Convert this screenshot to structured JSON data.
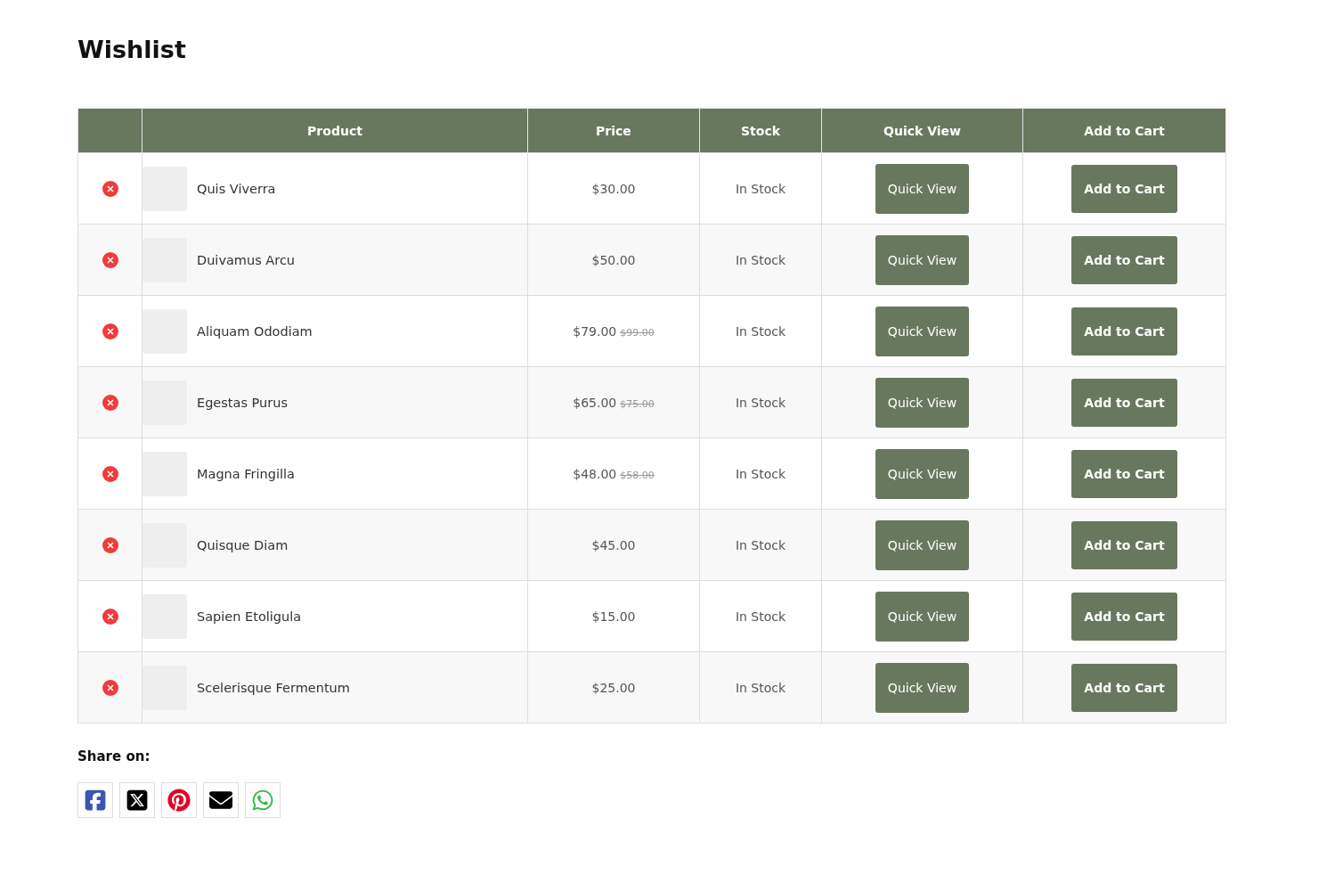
{
  "title": "Wishlist",
  "table": {
    "columns": [
      "Product",
      "Price",
      "Stock",
      "Quick View",
      "Add to Cart"
    ],
    "rows": [
      {
        "name": "Quis Viverra",
        "price": "$30.00",
        "stock": "In Stock",
        "quick_view": "Quick View",
        "add_to_cart": "Add to Cart"
      },
      {
        "name": "Duivamus Arcu",
        "price": "$50.00",
        "stock": "In Stock",
        "quick_view": "Quick View",
        "add_to_cart": "Add to Cart"
      },
      {
        "name": "Aliquam Ododiam",
        "price": "$79.00",
        "old_price": "$99.00",
        "stock": "In Stock",
        "quick_view": "Quick View",
        "add_to_cart": "Add to Cart"
      },
      {
        "name": "Egestas Purus",
        "price": "$65.00",
        "old_price": "$75.00",
        "stock": "In Stock",
        "quick_view": "Quick View",
        "add_to_cart": "Add to Cart"
      },
      {
        "name": "Magna Fringilla",
        "price": "$48.00",
        "old_price": "$58.00",
        "stock": "In Stock",
        "quick_view": "Quick View",
        "add_to_cart": "Add to Cart"
      },
      {
        "name": "Quisque Diam",
        "price": "$45.00",
        "stock": "In Stock",
        "quick_view": "Quick View",
        "add_to_cart": "Add to Cart"
      },
      {
        "name": "Sapien Etoligula",
        "price": "$15.00",
        "stock": "In Stock",
        "quick_view": "Quick View",
        "add_to_cart": "Add to Cart"
      },
      {
        "name": "Scelerisque Fermentum",
        "price": "$25.00",
        "stock": "In Stock",
        "quick_view": "Quick View",
        "add_to_cart": "Add to Cart"
      }
    ]
  },
  "share": {
    "label": "Share on:",
    "networks": [
      {
        "kind": "facebook"
      },
      {
        "kind": "x"
      },
      {
        "kind": "pinterest"
      },
      {
        "kind": "email"
      },
      {
        "kind": "whatsapp"
      }
    ]
  }
}
